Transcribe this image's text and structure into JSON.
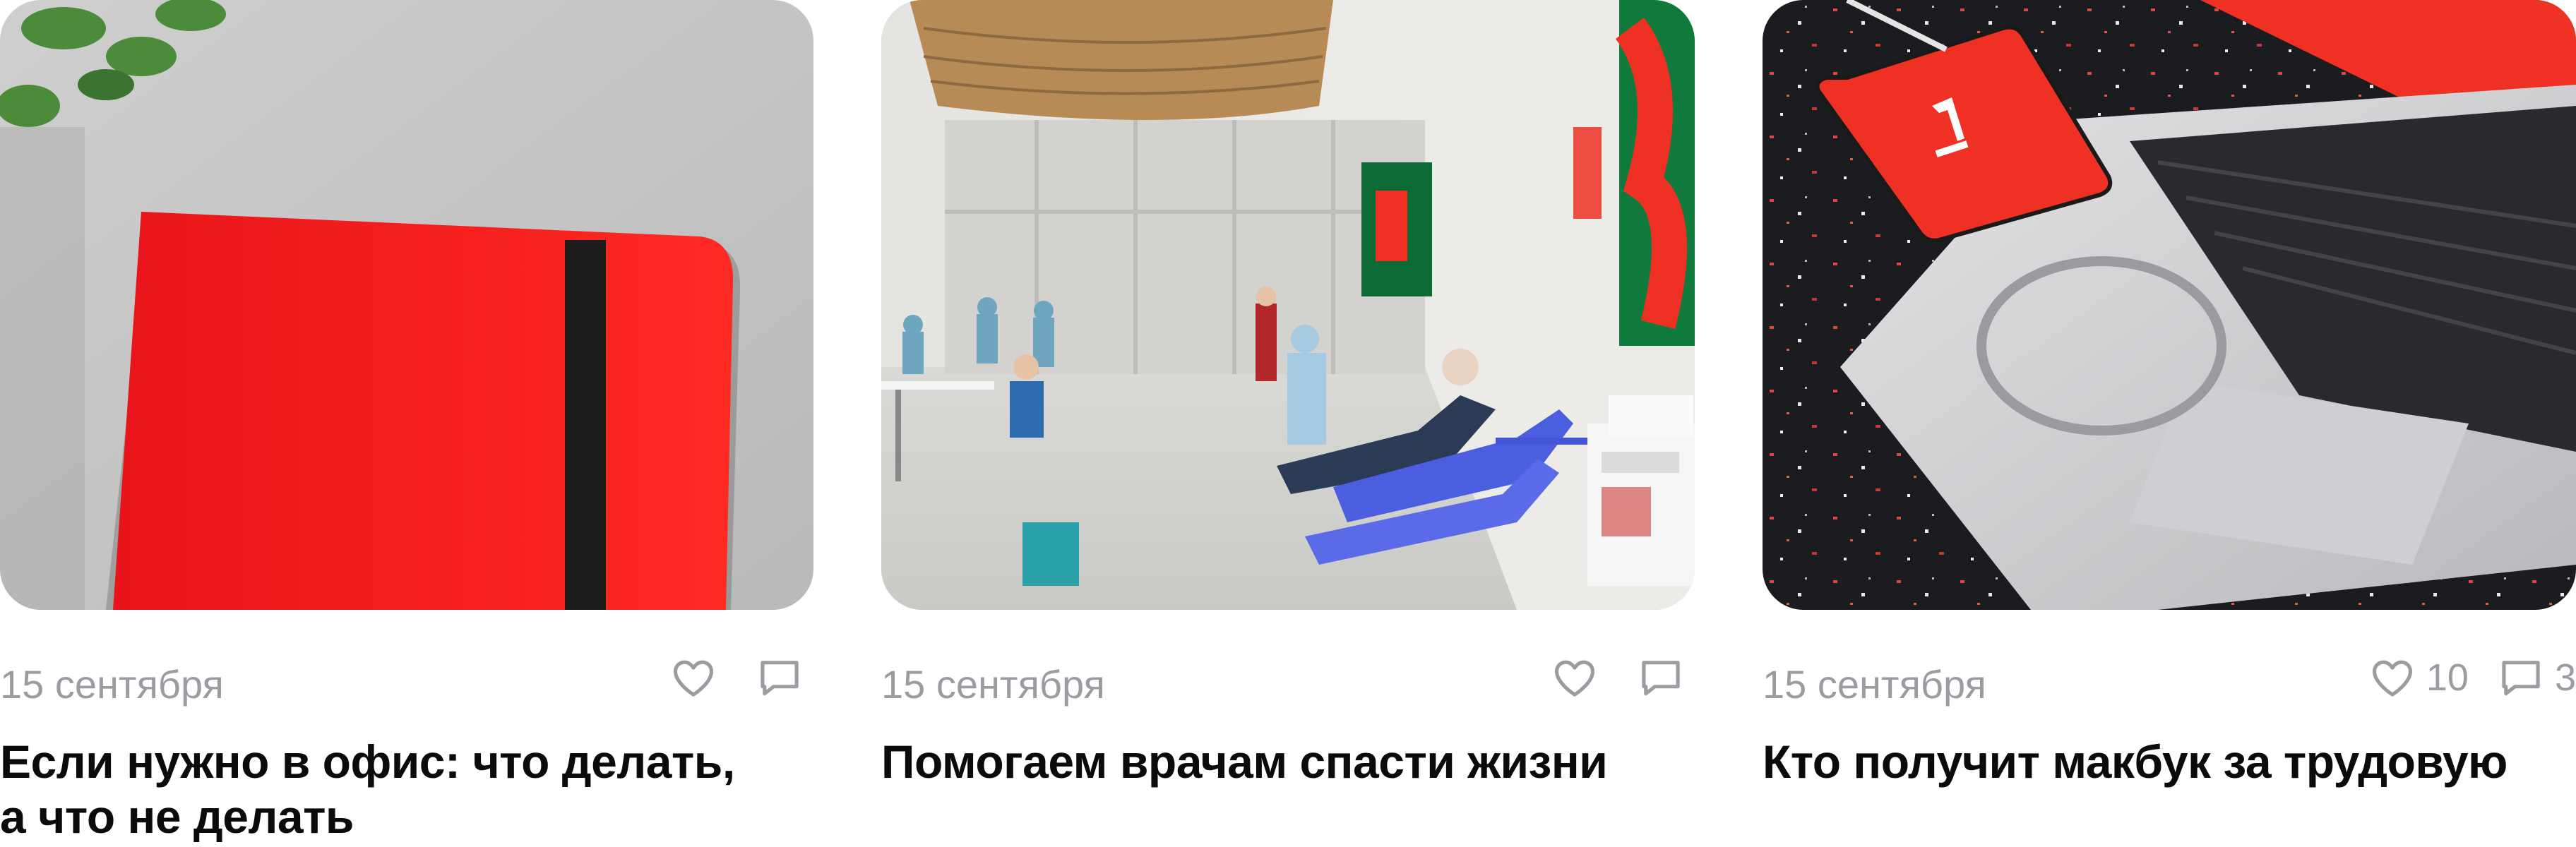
{
  "cards": [
    {
      "date": "15 сентября",
      "title_lines": [
        "Если нужно в офис: что делать,",
        "а что не делать"
      ],
      "likes": "",
      "comments": "",
      "image": "red-notebook-photo"
    },
    {
      "date": "15 сентября",
      "title_lines": [
        "Помогаем врачам спасти жизни"
      ],
      "likes": "",
      "comments": "",
      "image": "blood-donation-hall-photo"
    },
    {
      "date": "15 сентября",
      "title_lines": [
        "Кто получит макбук за трудовую"
      ],
      "likes": "10",
      "comments": "3",
      "image": "phone-on-laptop-photo"
    }
  ],
  "icons": {
    "like": "heart-icon",
    "comment": "comment-icon"
  },
  "colors": {
    "brand_red": "#ef3124",
    "meta_gray": "#9a9ca1",
    "title": "#0b0b0d"
  }
}
